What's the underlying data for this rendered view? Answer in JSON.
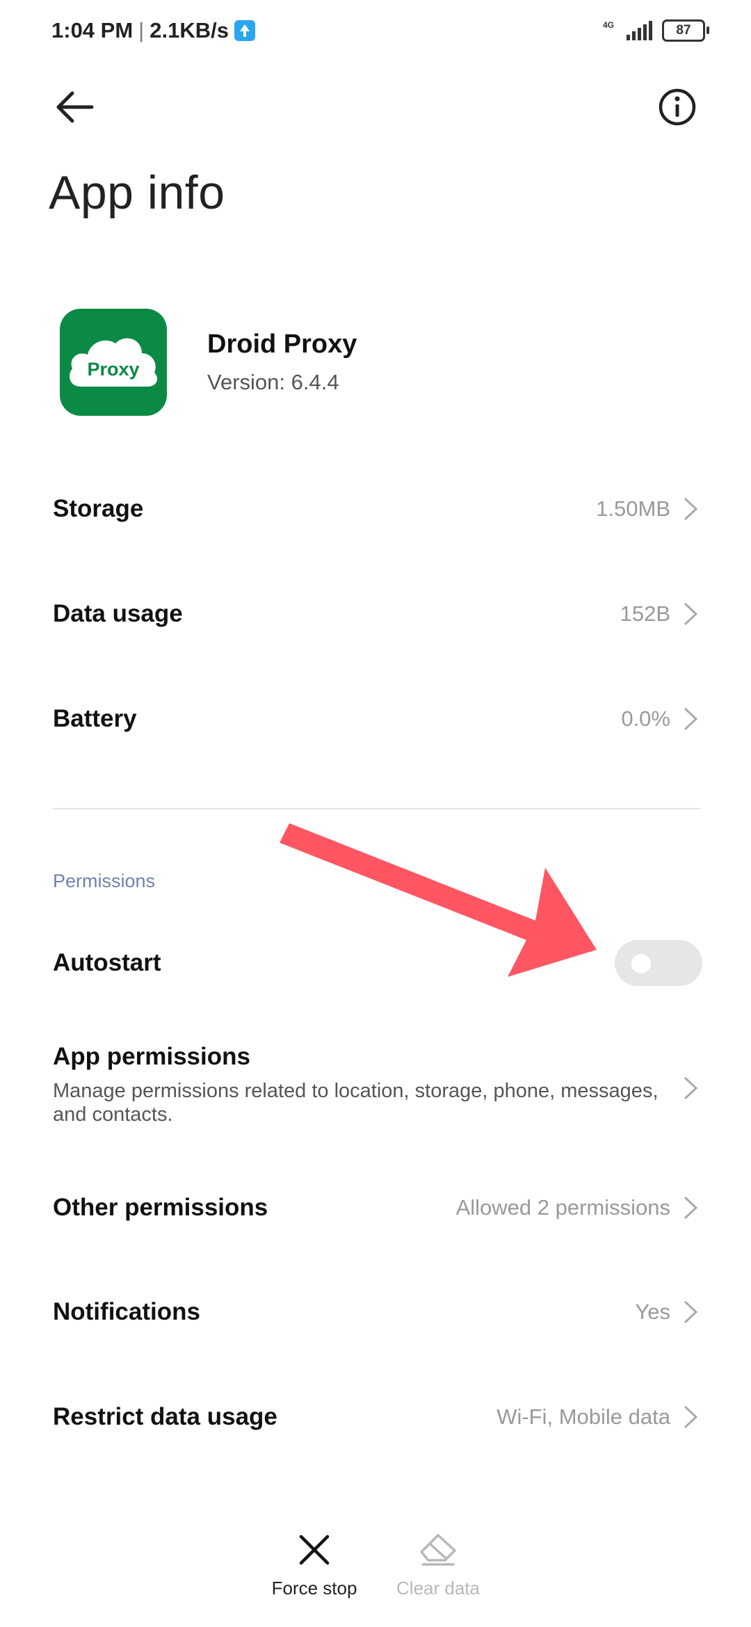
{
  "status_bar": {
    "time": "1:04 PM",
    "separator": "|",
    "speed": "2.1KB/s",
    "network": "4G",
    "battery": "87"
  },
  "header": {
    "title": "App info",
    "back_icon": "arrow-left-icon",
    "info_icon": "info-circle-icon"
  },
  "app": {
    "name": "Droid Proxy",
    "version": "Version: 6.4.4",
    "icon_text": "Proxy",
    "icon_color": "#0a8a44"
  },
  "rows": {
    "storage": {
      "label": "Storage",
      "value": "1.50MB"
    },
    "data_usage": {
      "label": "Data usage",
      "value": "152B"
    },
    "battery": {
      "label": "Battery",
      "value": "0.0%"
    }
  },
  "permissions": {
    "section_title": "Permissions",
    "autostart": {
      "label": "Autostart",
      "enabled": false
    },
    "app_permissions": {
      "label": "App permissions",
      "description": "Manage permissions related to location, storage, phone, messages, and contacts."
    },
    "other_permissions": {
      "label": "Other permissions",
      "value": "Allowed 2 permissions"
    },
    "notifications": {
      "label": "Notifications",
      "value": "Yes"
    },
    "restrict_data": {
      "label": "Restrict data usage",
      "value": "Wi-Fi, Mobile data"
    }
  },
  "bottom_actions": {
    "force_stop": "Force stop",
    "clear_data": "Clear data"
  },
  "colors": {
    "accent_section": "#6e82b0",
    "annotation_arrow": "#ff4d5a",
    "disabled_text": "#b8b8b8"
  }
}
